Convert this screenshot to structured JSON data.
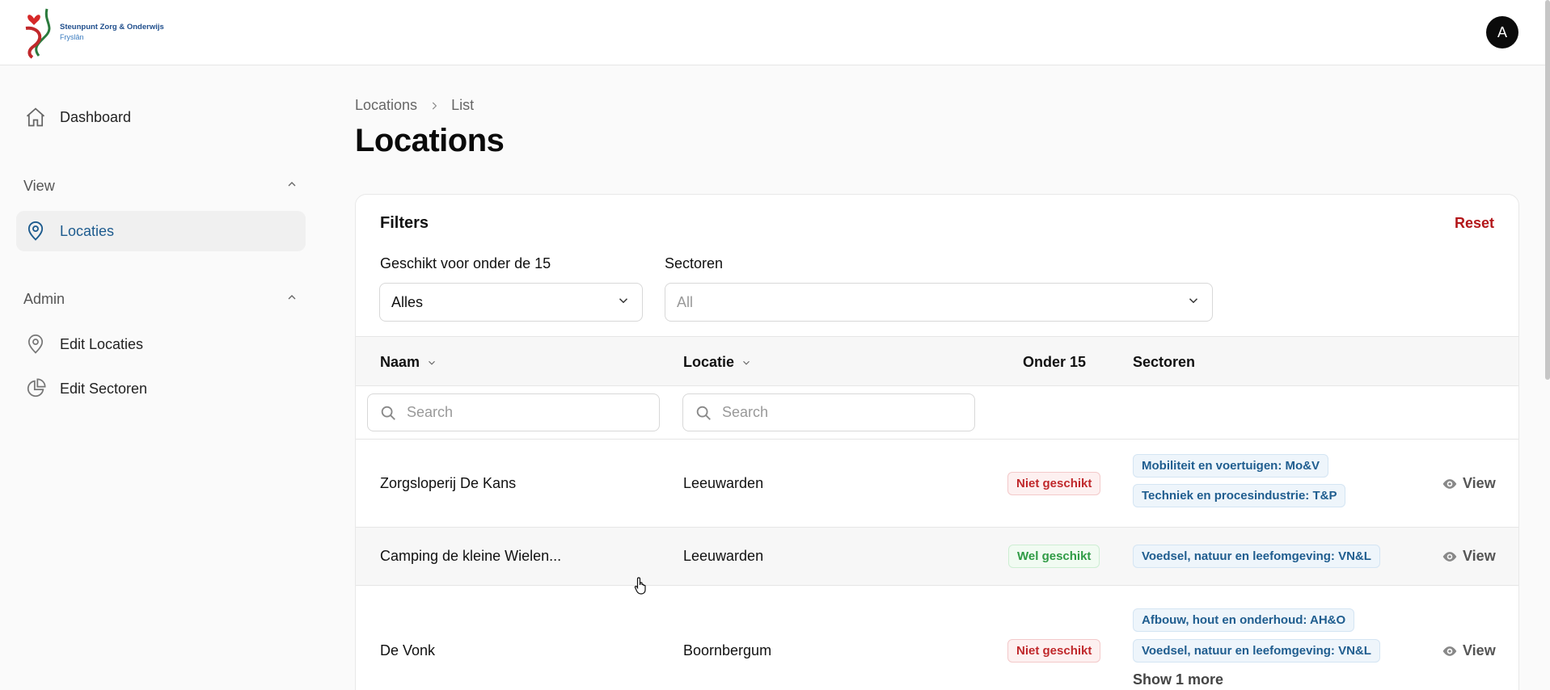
{
  "brand": {
    "line1": "Steunpunt Zorg & Onderwijs",
    "line2": "Fryslân"
  },
  "user": {
    "avatar_initial": "A"
  },
  "sidebar": {
    "dashboard": "Dashboard",
    "groups": [
      {
        "label": "View",
        "items": [
          {
            "label": "Locaties",
            "icon": "map-pin-icon",
            "active": true
          }
        ]
      },
      {
        "label": "Admin",
        "items": [
          {
            "label": "Edit Locaties",
            "icon": "map-pin-icon"
          },
          {
            "label": "Edit Sectoren",
            "icon": "pie-chart-icon"
          }
        ]
      }
    ]
  },
  "breadcrumb": [
    "Locations",
    "List"
  ],
  "page": {
    "title": "Locations"
  },
  "filters": {
    "title": "Filters",
    "reset_label": "Reset",
    "onder15": {
      "label": "Geschikt voor onder de 15",
      "value": "Alles"
    },
    "sectoren": {
      "label": "Sectoren",
      "placeholder": "All"
    }
  },
  "table": {
    "columns": {
      "naam": "Naam",
      "locatie": "Locatie",
      "onder15": "Onder 15",
      "sectoren": "Sectoren"
    },
    "search_placeholder": "Search",
    "view_label": "View",
    "rows": [
      {
        "naam": "Zorgsloperij De Kans",
        "locatie": "Leeuwarden",
        "onder15": "Niet geschikt",
        "sectoren": [
          "Mobiliteit en voertuigen: Mo&V",
          "Techniek en procesindustrie: T&P"
        ]
      },
      {
        "naam": "Camping de kleine Wielen...",
        "locatie": "Leeuwarden",
        "onder15": "Wel geschikt",
        "sectoren": [
          "Voedsel, natuur en leefomgeving: VN&L"
        ]
      },
      {
        "naam": "De Vonk",
        "locatie": "Boornbergum",
        "onder15": "Niet geschikt",
        "sectoren": [
          "Afbouw, hout en onderhoud: AH&O",
          "Voedsel, natuur en leefomgeving: VN&L"
        ],
        "more_label": "Show 1 more"
      }
    ]
  },
  "colors": {
    "accent": "#1d5b8e",
    "danger": "#b3171a",
    "success": "#2f9b45"
  }
}
